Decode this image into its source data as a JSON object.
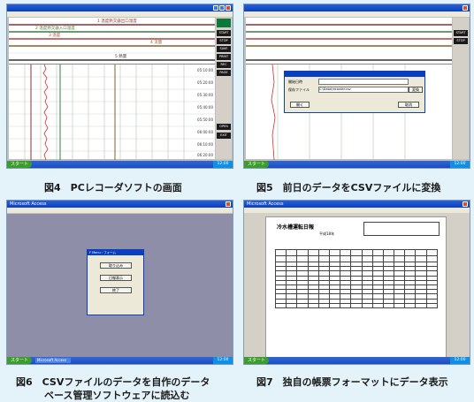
{
  "captions": {
    "fig4": "図4　PCレコーダソフトの画面",
    "fig5": "図5　前日のデータをCSVファイルに変換",
    "fig6_line1": "図6　CSVファイルのデータを自作のデータ",
    "fig6_line2": "ベース管理ソフトウェアに読込む",
    "fig7": "図7　独自の帳票フォーマットにデータ表示"
  },
  "recorder": {
    "markers": [
      "1 温度熱交器出口温度",
      "2 温度熱交器入口温度",
      "3 温度",
      "4 流量",
      "5 熱量"
    ],
    "side_buttons": [
      "START",
      "STOP",
      "SAVE",
      "PRINT",
      "REC",
      "PAGE",
      "OPEN",
      "EXIT"
    ],
    "times": [
      "05:10:00",
      "05:20:00",
      "05:30:00",
      "05:40:00",
      "05:50:00",
      "06:00:00",
      "06:10:00",
      "06:20:00"
    ]
  },
  "csv_dialog": {
    "label_period": "開始日時",
    "label_file": "保存ファイル",
    "ok_button": "開く",
    "convert_button": "変換",
    "cancel_button": "取消",
    "path": "C:\\Data\\recorder.csv"
  },
  "access": {
    "app_title": "Microsoft Access",
    "form_title": "F Menu : フォーム",
    "buttons": [
      "取り込み",
      "日報表示",
      "終了"
    ]
  },
  "report": {
    "title": "冷水槽運転日報",
    "subtitle": "平成18年",
    "app_title": "Microsoft Access"
  },
  "taskbar": {
    "start": "スタート",
    "clock": "12:00"
  }
}
